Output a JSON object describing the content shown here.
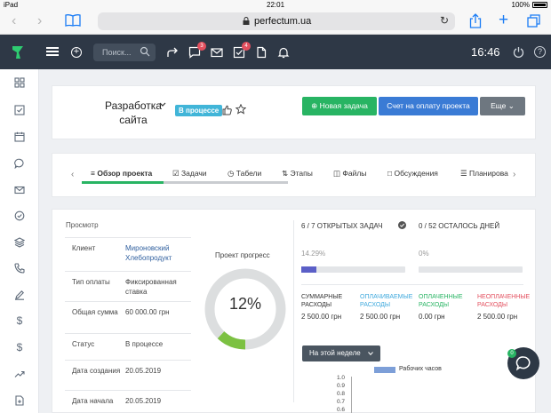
{
  "status_bar": {
    "device": "iPad",
    "time": "22:01",
    "battery": "100%"
  },
  "browser": {
    "url": "perfectum.ua"
  },
  "header": {
    "search_placeholder": "Поиск...",
    "badge_messages": "3",
    "badge_tasks": "4",
    "clock": "16:46",
    "help": "?"
  },
  "project": {
    "title_line1": "Разработка",
    "title_line2": "сайта",
    "status": "В процессе",
    "buttons": {
      "new_task": "Новая задача",
      "invoice": "Счет на оплату проекта",
      "more": "Еще"
    }
  },
  "tabs": {
    "overview": "Обзор проекта",
    "tasks": "Задачи",
    "timesheets": "Табели",
    "stages": "Этапы",
    "files": "Файлы",
    "discussions": "Обсуждения",
    "planning": "Планирова"
  },
  "overview": {
    "section_label": "Просмотр",
    "rows": [
      {
        "key": "Клиент",
        "value": "Мироновский Хлебопродукт"
      },
      {
        "key": "Тип оплаты",
        "value": "Фиксированная ставка"
      },
      {
        "key": "Общая сумма",
        "value": "60 000.00 грн"
      },
      {
        "key": "Статус",
        "value": "В процессе"
      },
      {
        "key": "Дата создания",
        "value": "20.05.2019"
      },
      {
        "key": "Дата начала",
        "value": "20.05.2019"
      }
    ],
    "progress_label": "Проект прогресс",
    "progress_value": "12%",
    "progress_fraction": 0.12
  },
  "stats": {
    "open_tasks_title": "6 / 7 ОТКРЫТЫХ ЗАДАЧ",
    "open_tasks_percent": "14.29%",
    "open_tasks_fraction": 0.1429,
    "days_left_title": "0 / 52 ОСТАЛОСЬ ДНЕЙ",
    "days_left_percent": "0%",
    "days_left_fraction": 0,
    "bar_color": "#5b5fc7"
  },
  "finance": [
    {
      "label": "СУММАРНЫЕ РАСХОДЫ",
      "value": "2 500.00 грн",
      "color": "#333333"
    },
    {
      "label": "ОПЛАЧИВАЕМЫЕ РАСХОДЫ",
      "value": "2 500.00 грн",
      "color": "#3fa9dd"
    },
    {
      "label": "ОПЛАЧЕННЫЕ РАСХОДЫ",
      "value": "0.00 грн",
      "color": "#28b463"
    },
    {
      "label": "НЕОПЛАЧЕННЫЕ РАСХОДЫ",
      "value": "2 500.00 грн",
      "color": "#e34f5e"
    }
  ],
  "chart": {
    "period": "На этой неделе",
    "legend": "Рабочих часов",
    "y_ticks": [
      "1.0",
      "0.9",
      "0.8",
      "0.7",
      "0.6"
    ]
  },
  "chat": {
    "badge": "0"
  },
  "colors": {
    "accent_green": "#28b463",
    "accent_blue": "#3a7bd5",
    "header_bg": "#2e3846"
  }
}
